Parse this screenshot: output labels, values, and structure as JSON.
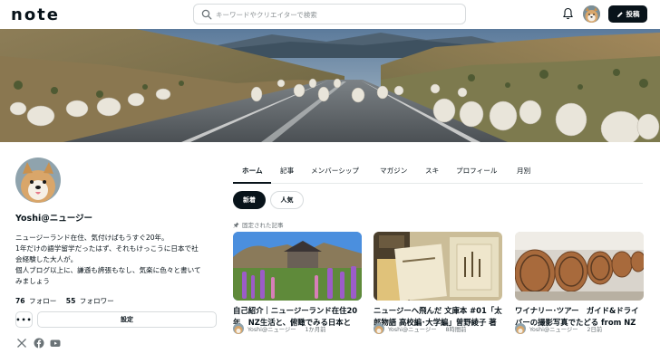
{
  "header": {
    "logo": "note",
    "search_placeholder": "キーワードやクリエイターで検索",
    "post_label": "投稿"
  },
  "profile": {
    "name": "Yoshi@ニュージー",
    "bio": [
      "ニュージーランド在住、気付けばもうすぐ20年。",
      "1年だけの語学留学だったはず、それもけっこうに日本で社",
      "会経験した大人が。",
      "個人ブログ以上に、謙遜も誇張もなし、気楽に色々と書いて",
      "みましょう"
    ],
    "following_count": "76",
    "following_label": "フォロー",
    "followers_count": "55",
    "followers_label": "フォロワー",
    "more_label": "•••",
    "settings_label": "設定"
  },
  "tabs": [
    "ホーム",
    "記事",
    "メンバーシップ",
    "マガジン",
    "スキ",
    "プロフィール",
    "月別"
  ],
  "filters": {
    "new_label": "新着",
    "popular_label": "人気"
  },
  "pinned_label": "固定された記事",
  "cards": [
    {
      "title": "自己紹介｜ニュージーランド在住20年　NZ生活と、俯瞰でみる日本と",
      "author": "Yoshi@ニュージー",
      "time": "1か月前"
    },
    {
      "title": "ニュージーへ飛んだ 文庫本 #01「太郎物語 高校編･大学編」曽野綾子 著",
      "author": "Yoshi@ニュージー",
      "time": "8時間前"
    },
    {
      "title": "ワイナリー･ツアー　ガイド&ドライバーの撮影写真でたどる from NZ",
      "author": "Yoshi@ニュージー",
      "time": "2日前"
    }
  ],
  "colors": {
    "text": "#08131a",
    "accent_dark": "#08131a",
    "border": "#d7dbdd",
    "muted": "#6b7377"
  },
  "icons": [
    "search-icon",
    "bell-icon",
    "pencil-icon",
    "x-icon",
    "facebook-icon",
    "youtube-icon",
    "pin-icon"
  ]
}
